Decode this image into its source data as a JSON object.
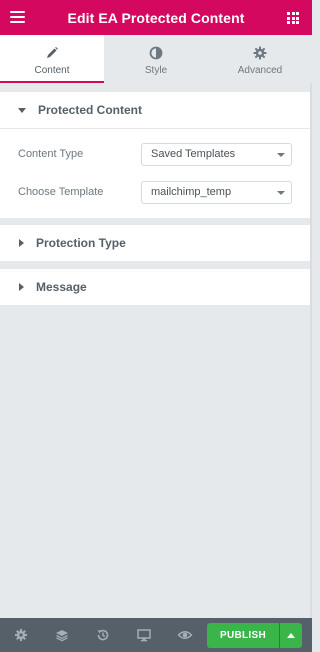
{
  "header": {
    "title": "Edit EA Protected Content",
    "bg_color": "#d5085f"
  },
  "tabs": [
    {
      "label": "Content",
      "icon": "pencil-icon",
      "active": true
    },
    {
      "label": "Style",
      "icon": "contrast-icon",
      "active": false
    },
    {
      "label": "Advanced",
      "icon": "gear-icon",
      "active": false
    }
  ],
  "sections": {
    "protected_content": {
      "label": "Protected Content",
      "expanded": true,
      "fields": [
        {
          "label": "Content Type",
          "value": "Saved Templates"
        },
        {
          "label": "Choose Template",
          "value": "mailchimp_temp"
        }
      ]
    },
    "protection_type": {
      "label": "Protection Type",
      "expanded": false
    },
    "message": {
      "label": "Message",
      "expanded": false
    }
  },
  "footer": {
    "icons": [
      "settings-icon",
      "layers-icon",
      "history-icon",
      "responsive-icon",
      "preview-icon"
    ],
    "publish_label": "PUBLISH",
    "publish_color": "#39b54a"
  }
}
